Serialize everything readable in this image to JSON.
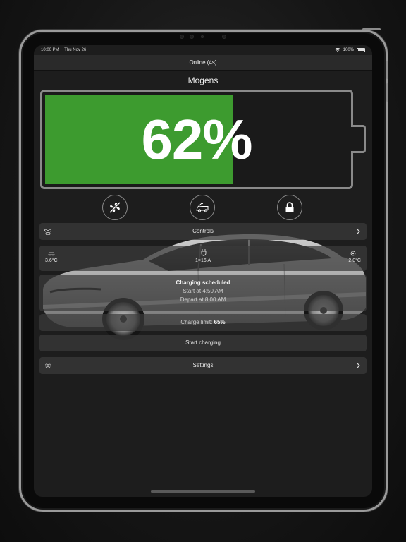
{
  "status_bar": {
    "time": "10:00 PM",
    "date": "Thu Nov 26",
    "battery_pct": "100%"
  },
  "nav": {
    "title": "Online (4s)"
  },
  "vehicle": {
    "name": "Mogens"
  },
  "battery": {
    "percent_label": "62%",
    "level": 0.62,
    "fill_color": "#3d9b2f"
  },
  "quick_actions": [
    {
      "icon": "fan-off-icon"
    },
    {
      "icon": "frunk-icon"
    },
    {
      "icon": "lock-icon"
    }
  ],
  "controls": {
    "label": "Controls",
    "icon": "command-icon"
  },
  "climate": {
    "inside_temp": "3.6°C",
    "outside_temp": "2.0°C",
    "charger": "1×16 A"
  },
  "schedule": {
    "title": "Charging scheduled",
    "start": "Start at 4:50 AM",
    "depart": "Depart at 8:00 AM"
  },
  "charge_limit": {
    "label": "Charge limit:",
    "value": "65%"
  },
  "start_charging": {
    "label": "Start charging"
  },
  "settings": {
    "label": "Settings",
    "icon": "gear-icon"
  }
}
